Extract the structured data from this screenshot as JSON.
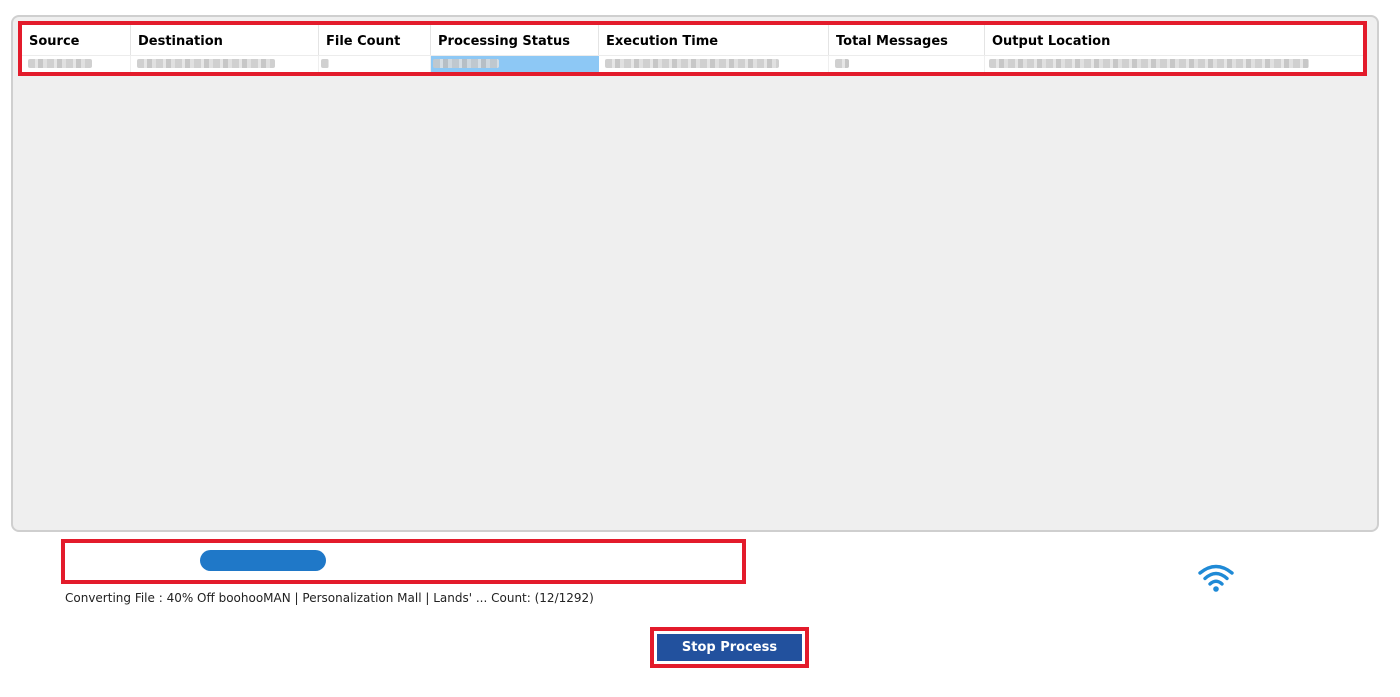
{
  "table": {
    "columns": [
      {
        "label": "Source"
      },
      {
        "label": "Destination"
      },
      {
        "label": "File Count"
      },
      {
        "label": "Processing Status"
      },
      {
        "label": "Execution Time"
      },
      {
        "label": "Total Messages"
      },
      {
        "label": "Output Location"
      }
    ]
  },
  "progress": {
    "status_text": "Converting File : 40% Off boohooMAN | Personalization Mall | Lands' ... Count: (12/1292)"
  },
  "actions": {
    "stop_label": "Stop Process"
  },
  "colors": {
    "highlight_border": "#e31b2b",
    "stop_button": "#22519e",
    "progress_fill": "#1f78c8",
    "wifi_icon": "#1f8ad6",
    "status_cell": "#8dc8f5"
  },
  "icons": {
    "connection": "wifi-icon"
  }
}
